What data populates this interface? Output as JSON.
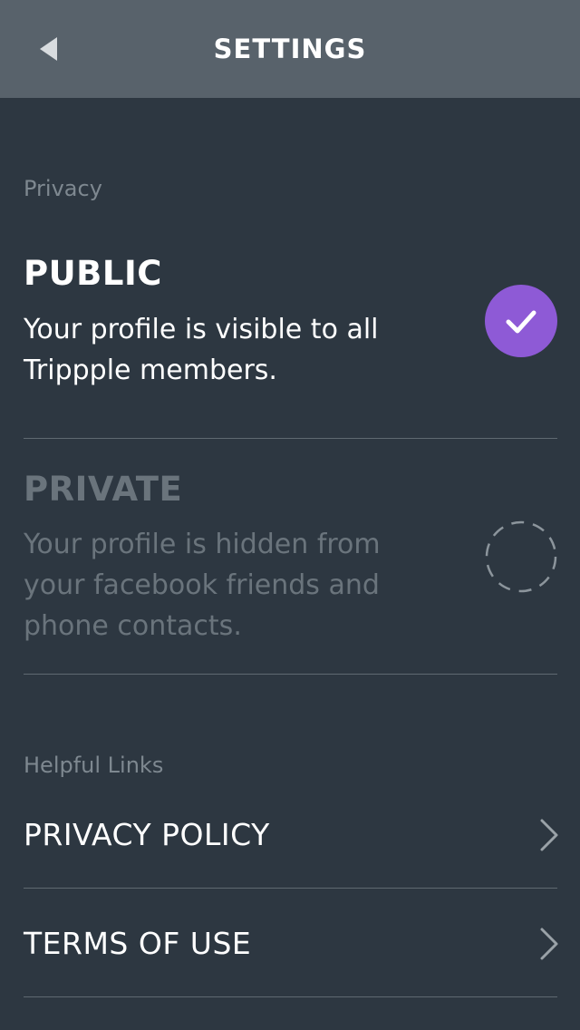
{
  "header": {
    "title": "SETTINGS",
    "back_icon": "back-triangle-icon"
  },
  "privacy": {
    "section_label": "Privacy",
    "options": [
      {
        "title": "PUBLIC",
        "description": "Your profile is visible to all Trippple members.",
        "selected": true
      },
      {
        "title": "PRIVATE",
        "description": "Your profile is hidden from your facebook friends and phone contacts.",
        "selected": false
      }
    ]
  },
  "helpful_links": {
    "section_label": "Helpful Links",
    "items": [
      {
        "label": "PRIVACY POLICY",
        "icon": "chevron-right-icon"
      },
      {
        "label": "TERMS OF USE",
        "icon": "chevron-right-icon"
      }
    ]
  },
  "colors": {
    "background": "#2d3741",
    "header": "#58626b",
    "accent": "#8e5ad6",
    "muted_text": "#6a747c",
    "divider": "#5f6971"
  }
}
